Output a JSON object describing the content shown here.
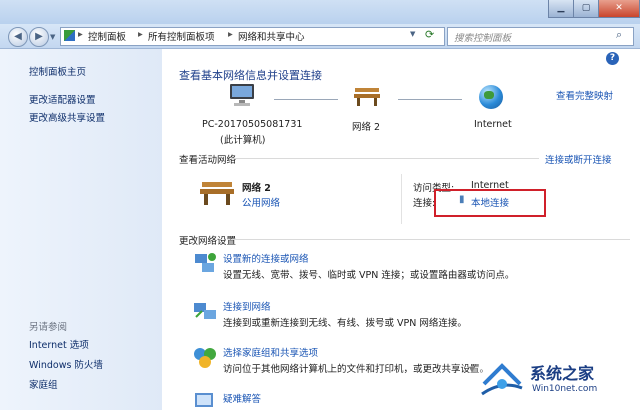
{
  "breadcrumb": [
    "控制面板",
    "所有控制面板项",
    "网络和共享中心"
  ],
  "search": {
    "placeholder": "搜索控制面板"
  },
  "sidebar": {
    "home": "控制面板主页",
    "links": [
      "更改适配器设置",
      "更改高级共享设置"
    ],
    "see_also_title": "另请参阅",
    "see_also": [
      "Internet 选项",
      "Windows 防火墙",
      "家庭组"
    ]
  },
  "main": {
    "title": "查看基本网络信息并设置连接",
    "view_full_map": "查看完整映射",
    "map": {
      "computer_name": "PC-20170505081731",
      "computer_sub": "(此计算机)",
      "network": "网络  2",
      "internet": "Internet"
    },
    "active_title": "查看活动网络",
    "connect_disconnect": "连接或断开连接",
    "active": {
      "name": "网络  2",
      "type": "公用网络",
      "access_label": "访问类型:",
      "access_value": "Internet",
      "conn_label": "连接:",
      "conn_value": "本地连接"
    },
    "change_title": "更改网络设置",
    "tasks": [
      {
        "title": "设置新的连接或网络",
        "desc": "设置无线、宽带、拨号、临时或 VPN 连接；或设置路由器或访问点。"
      },
      {
        "title": "连接到网络",
        "desc": "连接到或重新连接到无线、有线、拨号或 VPN 网络连接。"
      },
      {
        "title": "选择家庭组和共享选项",
        "desc": "访问位于其他网络计算机上的文件和打印机，或更改共享设置。"
      },
      {
        "title": "疑难解答",
        "desc": ""
      }
    ]
  },
  "watermark": {
    "line1": "系统之家",
    "line2": "Win10net.com"
  },
  "colors": {
    "link": "#1a55b4",
    "highlight": "#d0202a"
  }
}
